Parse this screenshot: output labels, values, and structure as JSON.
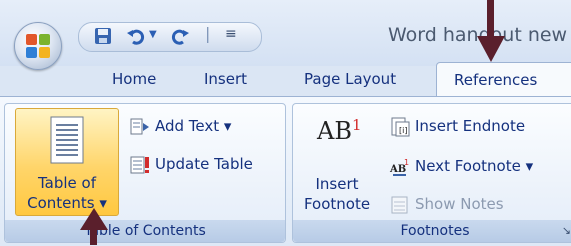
{
  "window": {
    "title": "Word handout new"
  },
  "qat": {
    "separator": "|",
    "customize": "≡"
  },
  "tabs": {
    "home": "Home",
    "insert": "Insert",
    "page_layout": "Page Layout",
    "references": "References"
  },
  "toc_group": {
    "toc_label_line1": "Table of",
    "toc_label_line2": "Contents ▾",
    "add_text": "Add Text ▾",
    "update_table": "Update Table",
    "group_label": "Table of Contents"
  },
  "footnotes_group": {
    "insert_footnote_line1": "Insert",
    "insert_footnote_line2": "Footnote",
    "ab_glyph": "AB",
    "ab_superscript": "1",
    "insert_endnote": "Insert Endnote",
    "next_footnote": "Next Footnote ▾",
    "show_notes": "Show Notes",
    "group_label": "Footnotes",
    "dialog_launcher": "↘"
  }
}
